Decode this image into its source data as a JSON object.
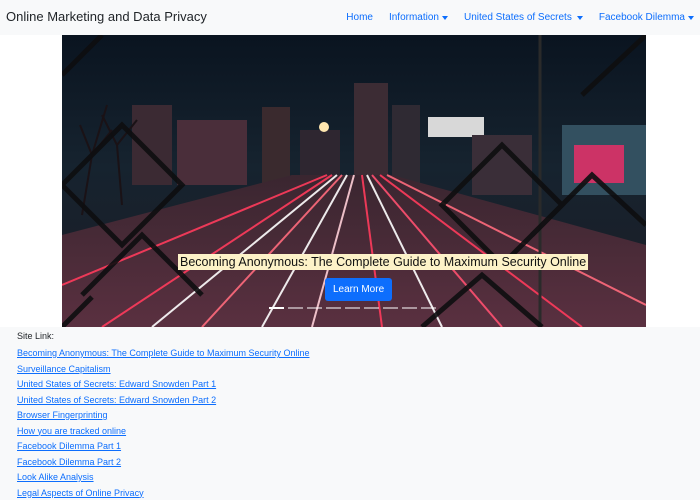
{
  "navbar": {
    "brand": "Online Marketing and Data Privacy",
    "items": [
      {
        "label": "Home",
        "dropdown": false
      },
      {
        "label": "Information",
        "dropdown": true
      },
      {
        "label": "United States of Secrets",
        "dropdown": true
      },
      {
        "label": "Facebook Dilemma",
        "dropdown": true
      }
    ],
    "accent_color": "#0d6efd"
  },
  "carousel": {
    "caption": "Becoming Anonymous: The Complete Guide to Maximum Security Online",
    "button_label": "Learn More",
    "slide_count": 9,
    "active_index": 0,
    "image_description_icon": "city-highway-chainlink-fence-image"
  },
  "site_links": {
    "label": "Site Link:",
    "links": [
      "Becoming Anonymous: The Complete Guide to Maximum Security Online",
      "Surveillance Capitalism",
      "United States of Secrets: Edward Snowden Part 1",
      "United States of Secrets: Edward Snowden Part 2",
      "Browser Fingerprinting",
      "How you are tracked online",
      "Facebook Dilemma Part 1",
      "Facebook Dilemma Part 2",
      "Look Alike Analysis",
      "Legal Aspects of Online Privacy"
    ]
  }
}
